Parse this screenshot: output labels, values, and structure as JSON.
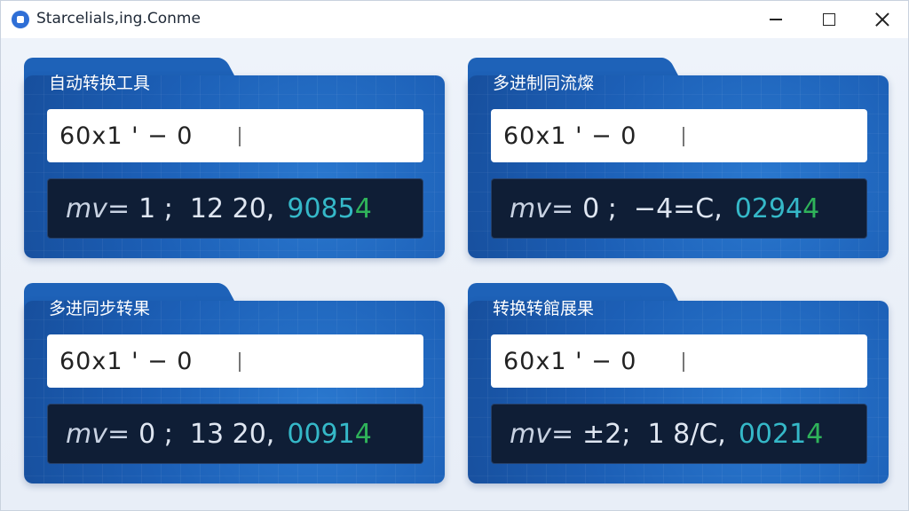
{
  "window": {
    "title": "Starcelials,ing.Conme"
  },
  "panels": [
    {
      "title": "自动转换工具",
      "input": "60x1 ' − 0",
      "output_label": "mv=",
      "output_mid": "1 ;  12 20,",
      "output_hex": "9085",
      "output_tail": "4"
    },
    {
      "title": "多进制同流燦",
      "input": "60x1 ' − 0",
      "output_label": "mv=",
      "output_mid": "0 ;  −4=C,",
      "output_hex": "0294",
      "output_tail": "4"
    },
    {
      "title": "多进同步转果",
      "input": "60x1 ' − 0",
      "output_label": "mv=",
      "output_mid": "0 ;  13 20,",
      "output_hex": "0091",
      "output_tail": "4"
    },
    {
      "title": "转换转館展果",
      "input": "60x1 ' − 0",
      "output_label": "mv=",
      "output_mid": "±2;  1 8/C,",
      "output_hex": "0021",
      "output_tail": "4"
    }
  ],
  "colors": {
    "accent": "#1e62b8",
    "output_bg": "#0f1e36",
    "hex_text": "#35b8c8",
    "tail_text": "#2fb35a"
  },
  "icons": {
    "app": "app-logo-icon",
    "minimize": "minimize-icon",
    "maximize": "maximize-icon",
    "close": "close-icon"
  }
}
